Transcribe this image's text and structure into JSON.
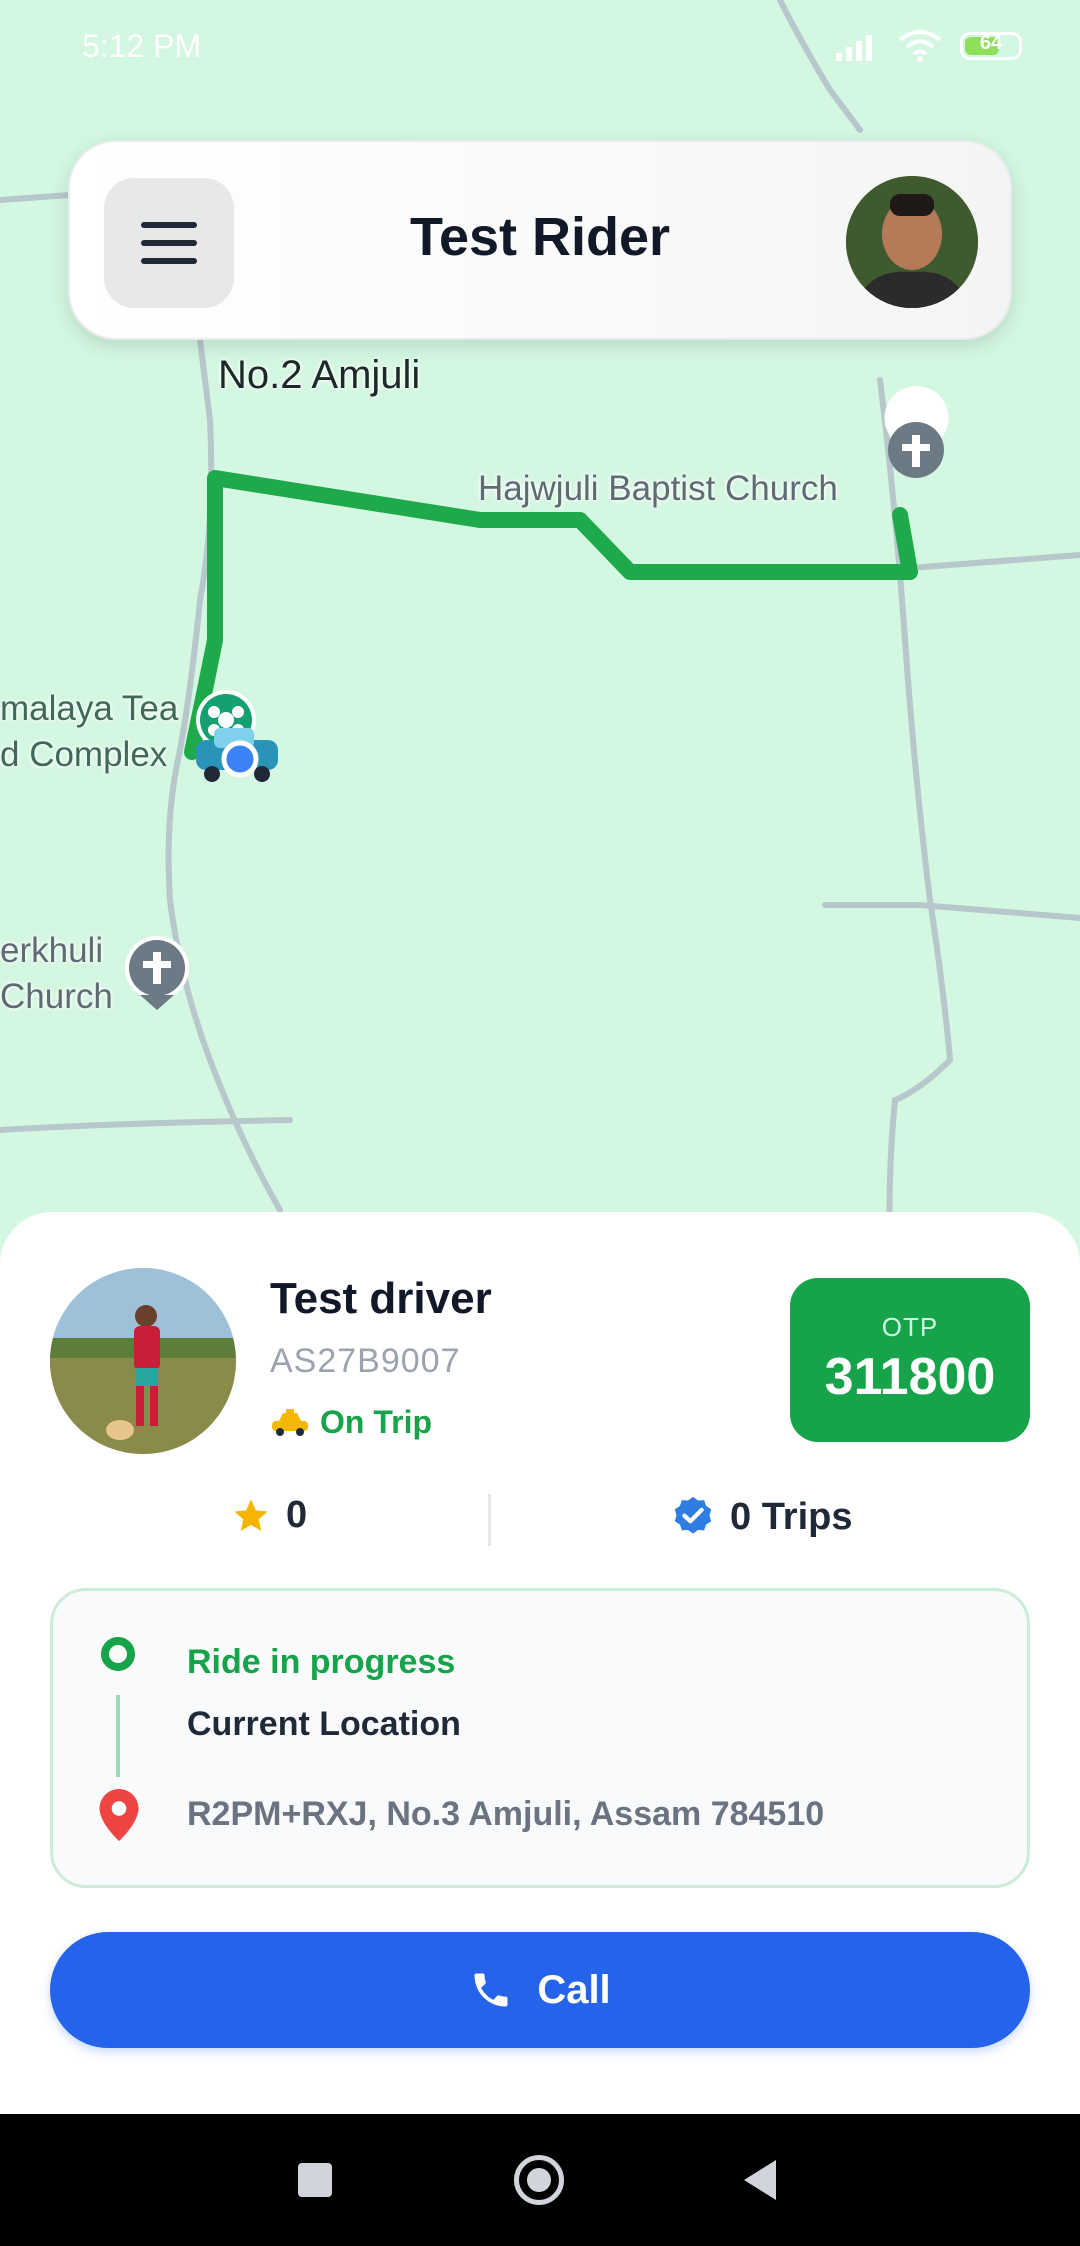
{
  "status_bar": {
    "time": "5:12 PM",
    "battery": "64"
  },
  "header": {
    "title": "Test Rider",
    "menu_icon": "menu-icon",
    "avatar_icon": "user-avatar"
  },
  "map": {
    "labels": {
      "place1": "No.2 Amjuli",
      "place2": "Hajwjuli Baptist Church",
      "place3_line1": "malaya Tea",
      "place3_line2": "d Complex",
      "place4_line1": "erkhuli",
      "place4_line2": "Church"
    },
    "route_color": "#1ea94b"
  },
  "driver": {
    "name": "Test driver",
    "plate": "AS27B9007",
    "status": "On Trip",
    "status_icon": "taxi-icon"
  },
  "otp": {
    "label": "OTP",
    "value": "311800"
  },
  "stats": {
    "rating": "0",
    "trips": "0 Trips"
  },
  "route": {
    "status": "Ride in progress",
    "current": "Current Location",
    "destination": "R2PM+RXJ, No.3 Amjuli, Assam 784510"
  },
  "call_button": {
    "label": "Call"
  },
  "colors": {
    "accent_green": "#16a34a",
    "call_blue": "#2563eb",
    "map_bg": "#d3f7e0"
  }
}
